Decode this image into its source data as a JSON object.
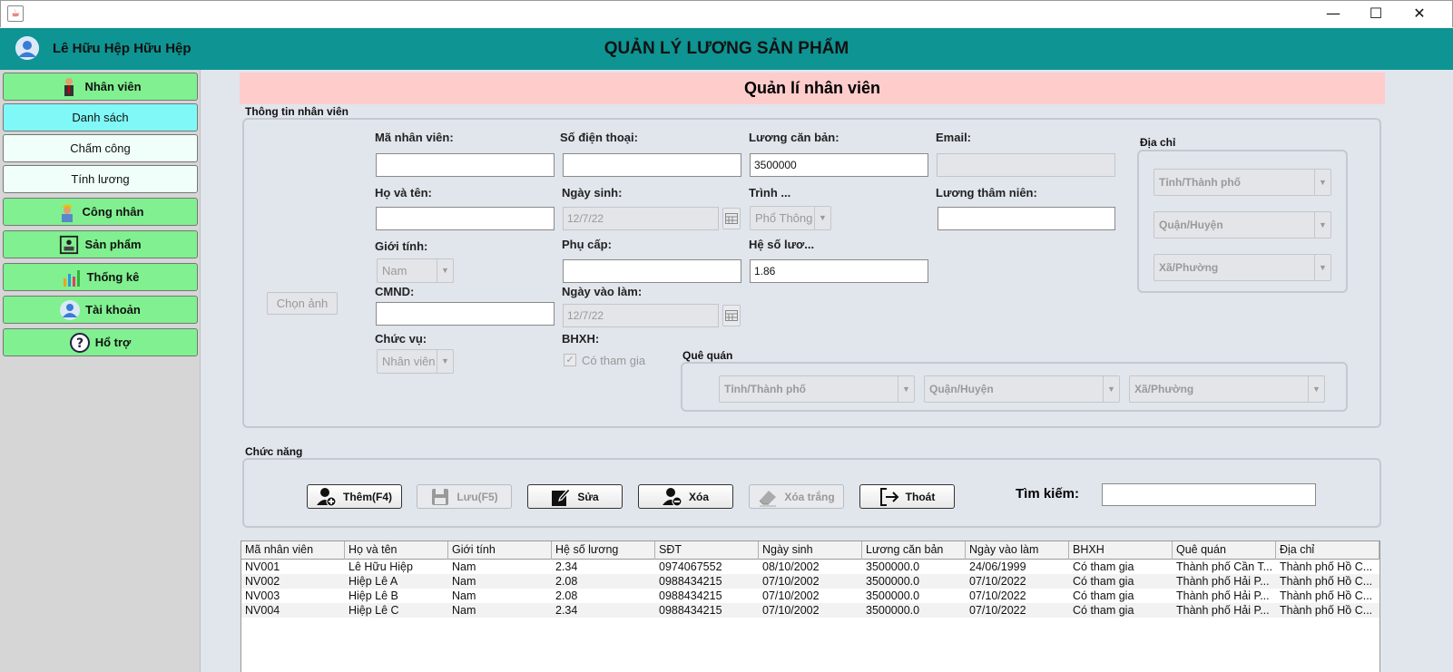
{
  "window": {
    "minimize": "—",
    "maximize": "☐",
    "close": "✕"
  },
  "header": {
    "user_name": "Lê Hữu Hệp Hữu Hệp",
    "title": "QUẢN LÝ LƯƠNG SẢN PHẨM"
  },
  "sidebar": {
    "items": [
      {
        "label": "Nhân viên",
        "icon": "employee-icon"
      },
      {
        "label": "Danh sách"
      },
      {
        "label": "Chấm công"
      },
      {
        "label": "Tính lương"
      },
      {
        "label": "Công nhân",
        "icon": "worker-icon"
      },
      {
        "label": "Sản phẩm",
        "icon": "product-icon"
      },
      {
        "label": "Thống kê",
        "icon": "chart-icon"
      },
      {
        "label": "Tài khoản",
        "icon": "account-icon"
      },
      {
        "label": "Hổ trợ",
        "icon": "help-icon"
      }
    ]
  },
  "section_title": "Quản lí nhân viên",
  "info": {
    "group_label": "Thông tin nhân viên",
    "photo_button": "Chọn ảnh",
    "employee_id": {
      "label": "Mã nhân viên:",
      "value": ""
    },
    "phone": {
      "label": "Số điện thoại:",
      "value": ""
    },
    "base_salary": {
      "label": "Lương căn bản:",
      "value": "3500000"
    },
    "email": {
      "label": "Email:",
      "value": ""
    },
    "full_name": {
      "label": "Họ và tên:",
      "value": ""
    },
    "birthday": {
      "label": "Ngày sinh:",
      "value": "12/7/22"
    },
    "education": {
      "label": "Trình ...",
      "value": "Phổ Thông"
    },
    "seniority_salary": {
      "label": "Lương thâm niên:",
      "value": ""
    },
    "gender": {
      "label": "Giới tính:",
      "value": "Nam"
    },
    "allowance": {
      "label": "Phụ cấp:",
      "value": ""
    },
    "salary_coef": {
      "label": "Hệ số lươ...",
      "value": "1.86"
    },
    "id_card": {
      "label": "CMND:",
      "value": ""
    },
    "start_date": {
      "label": "Ngày vào làm:",
      "value": "12/7/22"
    },
    "position": {
      "label": "Chức vụ:",
      "value": "Nhân viên"
    },
    "insurance": {
      "label": "BHXH:",
      "checkbox_label": "Có tham gia"
    },
    "address": {
      "label": "Địa chỉ",
      "province": "Tỉnh/Thành phố",
      "district": "Quận/Huyện",
      "ward": "Xã/Phường"
    },
    "hometown": {
      "label": "Quê quán",
      "province": "Tỉnh/Thành phố",
      "district": "Quận/Huyện",
      "ward": "Xã/Phường"
    }
  },
  "functions": {
    "group_label": "Chức năng",
    "add": "Thêm(F4)",
    "save": "Lưu(F5)",
    "edit": "Sửa",
    "delete": "Xóa",
    "clear": "Xóa trắng",
    "exit": "Thoát",
    "search_label": "Tìm kiếm:",
    "search_value": ""
  },
  "table": {
    "columns": [
      "Mã nhân viên",
      "Họ và tên",
      "Giới tính",
      "Hệ số lương",
      "SĐT",
      "Ngày sinh",
      "Lương căn bản",
      "Ngày vào làm",
      "BHXH",
      "Quê quán",
      "Địa chỉ"
    ],
    "rows": [
      [
        "NV001",
        "Lê Hữu Hiệp",
        "Nam",
        "2.34",
        "0974067552",
        "08/10/2002",
        "3500000.0",
        "24/06/1999",
        "Có tham gia",
        "Thành phố Cần T...",
        "Thành phố Hồ C..."
      ],
      [
        "NV002",
        "Hiệp Lê A",
        "Nam",
        "2.08",
        "0988434215",
        "07/10/2002",
        "3500000.0",
        "07/10/2022",
        "Có tham gia",
        "Thành phố Hải P...",
        "Thành phố Hồ C..."
      ],
      [
        "NV003",
        "Hiệp Lê B",
        "Nam",
        "2.08",
        "0988434215",
        "07/10/2002",
        "3500000.0",
        "07/10/2022",
        "Có tham gia",
        "Thành phố Hải P...",
        "Thành phố Hồ C..."
      ],
      [
        "NV004",
        "Hiệp Lê C",
        "Nam",
        "2.34",
        "0988434215",
        "07/10/2002",
        "3500000.0",
        "07/10/2022",
        "Có tham gia",
        "Thành phố Hải P...",
        "Thành phố Hồ C..."
      ]
    ]
  },
  "colors": {
    "header": "#0d9493",
    "sidebar_btn": "#80f090",
    "sidebar_active": "#80f8f8",
    "section_title_bg": "#ffcccc"
  }
}
